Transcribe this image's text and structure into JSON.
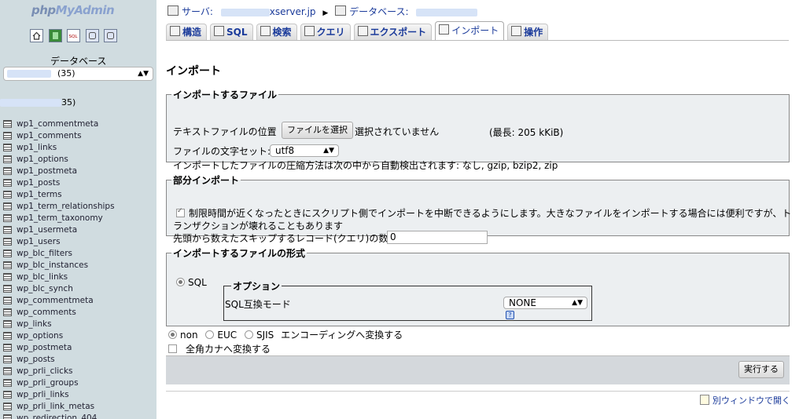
{
  "left": {
    "logo_pre": "php",
    "logo_post": "MyAdmin",
    "icons": [
      "home-icon",
      "logout-icon",
      "sql-query-icon",
      "docs-icon",
      "help-icon"
    ],
    "db_label": "データベース",
    "db_select_count": "(35)",
    "db_name_count": "35)",
    "tables": [
      "wp1_commentmeta",
      "wp1_comments",
      "wp1_links",
      "wp1_options",
      "wp1_postmeta",
      "wp1_posts",
      "wp1_terms",
      "wp1_term_relationships",
      "wp1_term_taxonomy",
      "wp1_usermeta",
      "wp1_users",
      "wp_blc_filters",
      "wp_blc_instances",
      "wp_blc_links",
      "wp_blc_synch",
      "wp_commentmeta",
      "wp_comments",
      "wp_links",
      "wp_options",
      "wp_postmeta",
      "wp_posts",
      "wp_prli_clicks",
      "wp_prli_groups",
      "wp_prli_links",
      "wp_prli_link_metas",
      "wp_redirection_404"
    ]
  },
  "crumb": {
    "server_label": "サーバ:",
    "server_value": "xserver.jp",
    "db_label": "データベース:"
  },
  "tabs": [
    {
      "label": "構造",
      "icon": "structure-icon"
    },
    {
      "label": "SQL",
      "icon": "sql-icon"
    },
    {
      "label": "検索",
      "icon": "search-icon"
    },
    {
      "label": "クエリ",
      "icon": "query-icon"
    },
    {
      "label": "エクスポート",
      "icon": "export-icon"
    },
    {
      "label": "インポート",
      "icon": "import-icon",
      "active": true
    },
    {
      "label": "操作",
      "icon": "operations-icon"
    }
  ],
  "page_title": "インポート",
  "file_section": {
    "legend": "インポートするファイル",
    "location_label": "テキストファイルの位置",
    "choose_button": "ファイルを選択",
    "no_file": "選択されていません",
    "max_size": "(最長: 205 kKiB)",
    "charset_label": "ファイルの文字セット:",
    "charset_value": "utf8",
    "compression_note": "インポートしたファイルの圧縮方法は次の中から自動検出されます: なし, gzip, bzip2, zip"
  },
  "partial_section": {
    "legend": "部分インポート",
    "interrupt_text_1": "制限時間が近くなったときにスクリプト側でインポートを中断できるようにします。大きなファイルをインポートする場合には便利ですが、ト",
    "interrupt_text_2": "ランザクションが壊れることもあります",
    "interrupt_checked": true,
    "skip_label": "先頭から数えたスキップするレコード(クエリ)の数",
    "skip_value": "0"
  },
  "format_section": {
    "legend": "インポートするファイルの形式",
    "format_sql": "SQL",
    "options_legend": "オプション",
    "compat_label": "SQL互換モード",
    "compat_value": "NONE",
    "help_glyph": "?"
  },
  "encoding": {
    "non": "non",
    "euc": "EUC",
    "sjis": "SJIS",
    "label": "エンコーディングへ変換する",
    "kana_label": "全角カナへ変換する",
    "selected": "non"
  },
  "submit_label": "実行する",
  "new_window_label": "別ウィンドウで開く"
}
